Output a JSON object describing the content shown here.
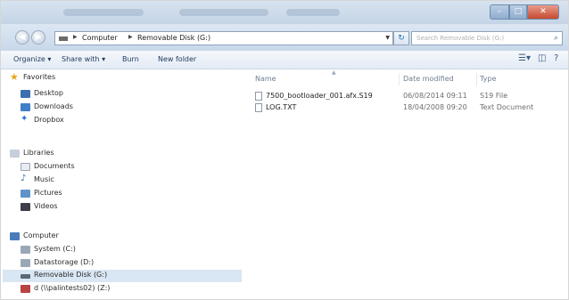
{
  "address": {
    "crumbs": [
      "Computer",
      "Removable Disk (G:)"
    ],
    "search_placeholder": "Search Removable Disk (G:)"
  },
  "toolbar": {
    "organize": "Organize ▾",
    "share_with": "Share with ▾",
    "burn": "Burn",
    "new_folder": "New folder"
  },
  "nav": {
    "favorites": {
      "label": "Favorites",
      "items": [
        "Desktop",
        "Downloads",
        "Dropbox"
      ]
    },
    "libraries": {
      "label": "Libraries",
      "items": [
        "Documents",
        "Music",
        "Pictures",
        "Videos"
      ]
    },
    "computer": {
      "label": "Computer",
      "items": [
        "System (C:)",
        "Datastorage (D:)",
        "Removable Disk (G:)",
        "d (\\\\palintests02) (Z:)"
      ]
    },
    "selected": "Removable Disk (G:)"
  },
  "columns": {
    "name": "Name",
    "date_modified": "Date modified",
    "type": "Type"
  },
  "files": [
    {
      "name": "7500_bootloader_001.afx.S19",
      "date": "06/08/2014 09:11",
      "type": "S19 File"
    },
    {
      "name": "LOG.TXT",
      "date": "18/04/2008 09:20",
      "type": "Text Document"
    }
  ]
}
